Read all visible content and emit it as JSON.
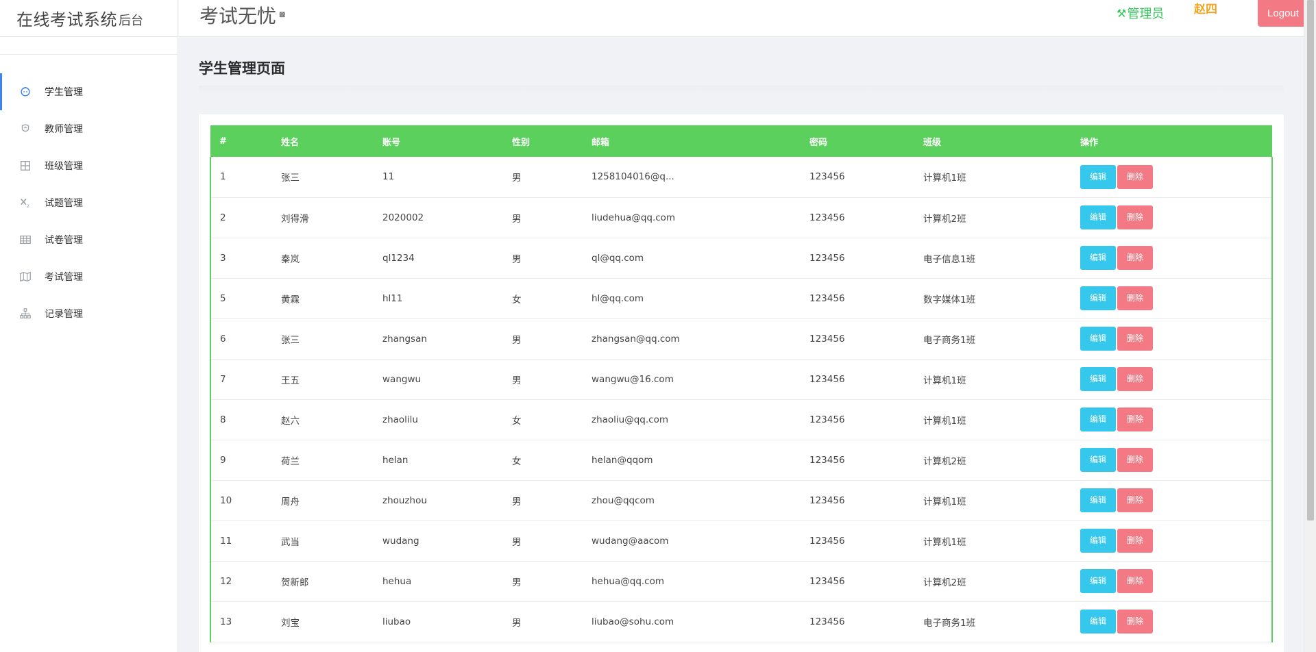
{
  "brand": {
    "main": "在线考试系统",
    "suffix": "后台"
  },
  "header": {
    "title": "考试无忧",
    "title_icon": "▩",
    "role_icon": "⚒",
    "role": "管理员",
    "user": "赵四",
    "logout": "Logout"
  },
  "sidebar": {
    "items": [
      {
        "label": "学生管理",
        "icon": "student-icon",
        "active": true
      },
      {
        "label": "教师管理",
        "icon": "teacher-icon"
      },
      {
        "label": "班级管理",
        "icon": "class-grid-icon"
      },
      {
        "label": "试题管理",
        "icon": "subscript-icon"
      },
      {
        "label": "试卷管理",
        "icon": "table-icon"
      },
      {
        "label": "考试管理",
        "icon": "map-icon"
      },
      {
        "label": "记录管理",
        "icon": "sitemap-icon"
      }
    ]
  },
  "page": {
    "title": "学生管理页面"
  },
  "table": {
    "headers": [
      "#",
      "姓名",
      "账号",
      "性别",
      "邮箱",
      "密码",
      "班级",
      "操作"
    ],
    "rows": [
      [
        "1",
        "张三",
        "11",
        "男",
        "1258104016@q...",
        "123456",
        "计算机1班"
      ],
      [
        "2",
        "刘得滑",
        "2020002",
        "男",
        "liudehua@qq.com",
        "123456",
        "计算机2班"
      ],
      [
        "3",
        "秦岚",
        "ql1234",
        "男",
        "ql@qq.com",
        "123456",
        "电子信息1班"
      ],
      [
        "5",
        "黄霖",
        "hl11",
        "女",
        "hl@qq.com",
        "123456",
        "数字媒体1班"
      ],
      [
        "6",
        "张三",
        "zhangsan",
        "男",
        "zhangsan@qq.com",
        "123456",
        "电子商务1班"
      ],
      [
        "7",
        "王五",
        "wangwu",
        "男",
        "wangwu@16.com",
        "123456",
        "计算机1班"
      ],
      [
        "8",
        "赵六",
        "zhaolilu",
        "女",
        "zhaoliu@qq.com",
        "123456",
        "计算机1班"
      ],
      [
        "9",
        "荷兰",
        "helan",
        "女",
        "helan@qqom",
        "123456",
        "计算机2班"
      ],
      [
        "10",
        "周舟",
        "zhouzhou",
        "男",
        "zhou@qqcom",
        "123456",
        "计算机1班"
      ],
      [
        "11",
        "武当",
        "wudang",
        "男",
        "wudang@aacom",
        "123456",
        "计算机1班"
      ],
      [
        "12",
        "贺新郎",
        "hehua",
        "男",
        "hehua@qq.com",
        "123456",
        "计算机2班"
      ],
      [
        "13",
        "刘宝",
        "liubao",
        "男",
        "liubao@sohu.com",
        "123456",
        "电子商务1班"
      ]
    ],
    "edit_label": "编辑",
    "delete_label": "删除"
  },
  "colors": {
    "table_header": "#5bd05d",
    "edit": "#35c7ec",
    "delete": "#f37a84",
    "role": "#34c759",
    "user": "#f0a422"
  }
}
